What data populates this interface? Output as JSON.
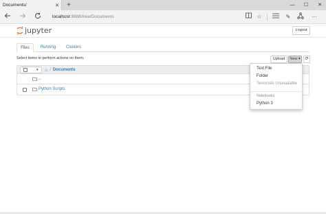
{
  "browser": {
    "tab_title": "Documents/",
    "tab_close": "✕",
    "new_tab": "+",
    "url_host": "localhost",
    "url_path": ":8888/tree/Documents",
    "win_minimize": "—",
    "win_maximize": "☐",
    "win_close": "✕"
  },
  "jupyter": {
    "logo_text": "jupyter",
    "logout_label": "Logout",
    "tabs": [
      {
        "label": "Files",
        "active": true
      },
      {
        "label": "Running",
        "active": false
      },
      {
        "label": "Clusters",
        "active": false
      }
    ],
    "select_msg": "Select items to perform actions on them.",
    "upload_label": "Upload",
    "new_label": "New ▾",
    "refresh_label": "⟳",
    "breadcrumb": {
      "home_icon": "home-icon",
      "separator": "/",
      "dir": "Documents"
    },
    "rows": [
      {
        "name": "..",
        "type": "folder"
      },
      {
        "name": "Python Scripts",
        "type": "folder"
      }
    ],
    "dropdown": {
      "items": [
        {
          "label": "Text File",
          "enabled": true
        },
        {
          "label": "Folder",
          "enabled": true
        },
        {
          "label": "Terminals Unavailable",
          "enabled": false
        }
      ],
      "header": "Notebooks",
      "kernels": [
        {
          "label": "Python 3"
        }
      ]
    }
  },
  "colors": {
    "link": "#337ab7",
    "jupyter_orange": "#f37726",
    "header_bg": "#eeeeee"
  }
}
